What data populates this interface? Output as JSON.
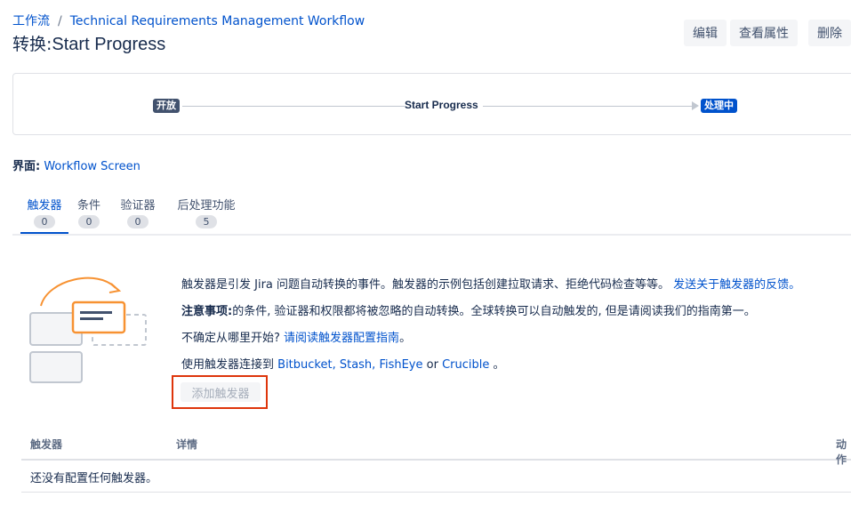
{
  "breadcrumb": {
    "root": "工作流",
    "separator": "/",
    "workflow": "Technical Requirements Management Workflow"
  },
  "title": {
    "prefix": "转换:",
    "name": "Start Progress"
  },
  "actions": {
    "edit": "编辑",
    "properties": "查看属性",
    "delete": "删除"
  },
  "diagram": {
    "from_status": "开放",
    "transition": "Start Progress",
    "to_status": "处理中",
    "from_color": "#42526e",
    "to_color": "#0052cc"
  },
  "screen": {
    "label": "界面:",
    "value": "Workflow Screen"
  },
  "tabs": [
    {
      "label": "触发器",
      "count": "0",
      "active": true
    },
    {
      "label": "条件",
      "count": "0",
      "active": false
    },
    {
      "label": "验证器",
      "count": "0",
      "active": false
    },
    {
      "label": "后处理功能",
      "count": "5",
      "active": false
    }
  ],
  "info": {
    "line1_text": "触发器是引发 Jira 问题自动转换的事件。触发器的示例包括创建拉取请求、拒绝代码检查等等。",
    "line1_link": "发送关于触发器的反馈。",
    "line2_bold": "注意事项:",
    "line2_text": "的条件, 验证器和权限都将被忽略的自动转换。全球转换可以自动触发的, 但是请阅读我们的指南第一。",
    "line3_text": "不确定从哪里开始?",
    "line3_link": "请阅读触发器配置指南",
    "line3_end": "。",
    "line4_text": "使用触发器连接到",
    "line4_links": "Bitbucket, Stash, FishEye",
    "line4_or": "or",
    "line4_link2": "Crucible",
    "line4_end": "。"
  },
  "add_button": "添加触发器",
  "highlight_color": "#de350b",
  "table": {
    "col_trigger": "触发器",
    "col_details": "详情",
    "col_actions": "动作",
    "empty": "还没有配置任何触发器。"
  }
}
